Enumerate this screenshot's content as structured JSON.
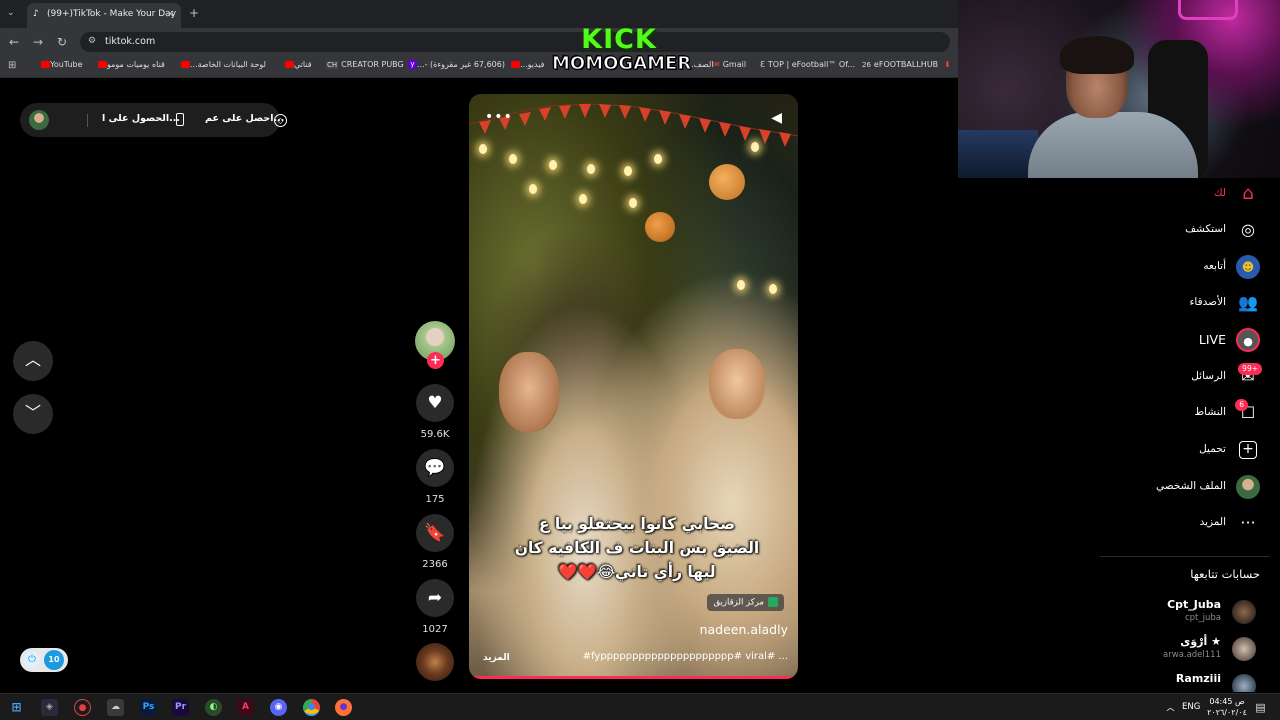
{
  "browser": {
    "tab_title": "(99+)TikTok - Make Your Day",
    "url": "tiktok.com",
    "bookmarks": [
      "YouTube",
      "قناه يوميات مومو",
      "لوحة البيانات الخاصة...",
      "قناتي",
      "CREATOR PUBG",
      "(67,606 غير مقروءة) -...",
      "فيديو...",
      "الصف...",
      "Gmail",
      "TOP | eFootball™ Of...",
      "eFOOTBALLHUB"
    ]
  },
  "overlay": {
    "line1": "KICK",
    "line2": "MOMOGAMER"
  },
  "top_bubble": {
    "item1": "الحصول على ا...",
    "item2": "احصل على عم..."
  },
  "video": {
    "caption_lines": [
      "صحابي كانوا بيحتفلو بيا ع",
      "الضيق بس البنات ف الكافيه كان",
      "ليها رأي تاني😂❤️❤️"
    ],
    "location": "مركز الزقازيق",
    "author": "nadeen.aladly",
    "description": "#fyppppppppppppppppppppp# viral# ...",
    "more_label": "المزيد"
  },
  "actions": {
    "likes": "59.6K",
    "comments": "175",
    "saves": "2366",
    "shares": "1027"
  },
  "sidebar": {
    "items": [
      {
        "label": "لك",
        "icon": "home-icon",
        "color": "#fe2c55"
      },
      {
        "label": "استكشف",
        "icon": "compass-icon"
      },
      {
        "label": "أتابعه",
        "icon": "following-avatar-icon"
      },
      {
        "label": "الأصدقاء",
        "icon": "friends-icon"
      },
      {
        "label": "LIVE",
        "icon": "live-icon"
      },
      {
        "label": "الرسائل",
        "icon": "messages-icon",
        "badge": "99+"
      },
      {
        "label": "النشاط",
        "icon": "activity-icon",
        "badge": "6"
      },
      {
        "label": "تحميل",
        "icon": "upload-icon"
      },
      {
        "label": "الملف الشخصي",
        "icon": "profile-avatar-icon"
      },
      {
        "label": "المزيد",
        "icon": "more-icon"
      }
    ],
    "following_title": "حسابات تتابعها",
    "accounts": [
      {
        "name": "Cpt_Juba",
        "handle": "cpt_juba"
      },
      {
        "name": "أرْوَى ★",
        "handle": "arwa.adel111"
      },
      {
        "name": "Ramziii",
        "handle": ""
      }
    ]
  },
  "taskbar": {
    "lang": "ENG",
    "time": "04:45 ص",
    "date": "٢٠٢٦/٠٢/٠٤"
  },
  "colors": {
    "accent": "#fe2c55",
    "kick_green": "#53fc18"
  }
}
